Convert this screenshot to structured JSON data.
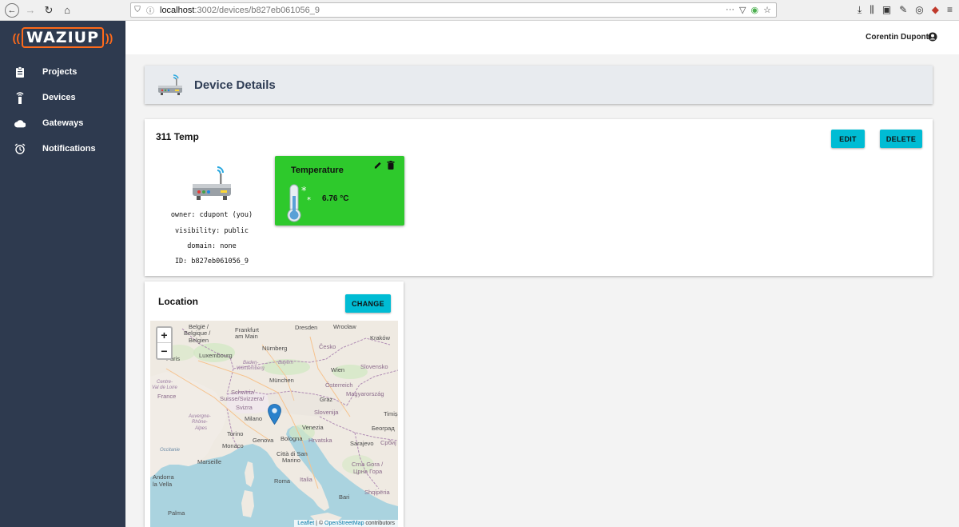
{
  "browser": {
    "url_host": "localhost",
    "url_path": ":3002/devices/b827eb061056_9",
    "url_more": "···"
  },
  "sidebar": {
    "logo_text": "WAZIUP",
    "items": [
      {
        "label": "Projects",
        "icon": "clipboard-icon"
      },
      {
        "label": "Devices",
        "icon": "antenna-icon"
      },
      {
        "label": "Gateways",
        "icon": "cloud-icon"
      },
      {
        "label": "Notifications",
        "icon": "alarm-icon"
      }
    ]
  },
  "appbar": {
    "user_name": "Corentin Dupont"
  },
  "header": {
    "title": "Device Details"
  },
  "device": {
    "name": "311 Temp",
    "edit_label": "EDIT",
    "delete_label": "DELETE",
    "owner": "owner: cdupont (you)",
    "visibility": "visibility: public",
    "domain": "domain: none",
    "id": "ID: b827eb061056_9"
  },
  "sensor": {
    "title": "Temperature",
    "value": "6.76 °C",
    "color": "#2ec92c"
  },
  "location": {
    "title": "Location",
    "change_label": "CHANGE",
    "zoom_in": "+",
    "zoom_out": "−",
    "attribution_leaflet": "Leaflet",
    "attribution_sep": " | © ",
    "attribution_osm": "OpenStreetMap",
    "attribution_rest": " contributors",
    "labels": {
      "belgie": "België /",
      "belgique": "Belgique /",
      "belgien": "Belgien",
      "frankfurt": "Frankfurt",
      "am_main": "am Main",
      "dresden": "Dresden",
      "wroclaw": "Wrocław",
      "krakow": "Kraków",
      "cesko": "Česko",
      "luxembourg": "Luxembourg",
      "nurnberg": "Nürnberg",
      "paris": "Paris",
      "baden": "Baden-",
      "wurttemberg": "Württemberg",
      "bayern": "Bayern",
      "wien": "Wien",
      "slovensko": "Slovensko",
      "munchen": "München",
      "osterreich": "Österreich",
      "centre": "Centre-",
      "val_de_loire": "Val de Loire",
      "france": "France",
      "schweiz": "Schweiz/",
      "suisse": "Suisse/Svizzera/",
      "svizra": "Svizra",
      "graz": "Graz",
      "magyarorszag": "Magyarország",
      "slovenija": "Slovenija",
      "timisoara": "Timiș",
      "auvergne": "Auvergne-",
      "rhone": "Rhône-",
      "alpes": "Alpes",
      "milano": "Milano",
      "venezia": "Venezia",
      "torino": "Torino",
      "hrvatska": "Hrvatska",
      "beograd": "Београд",
      "genova": "Genova",
      "bologna": "Bologna",
      "monaco": "Monaco",
      "sarajevo": "Sarajevo",
      "srbija": "Србиј",
      "occitanie": "Occitanie",
      "citta_di_san": "Città di San",
      "marino": "Marino",
      "marseille": "Marseille",
      "crna_gora": "Crna Gora /",
      "crna_gora_cyr": "Црна Гора",
      "andorra": "Andorra",
      "la_vella": "la Vella",
      "roma": "Roma",
      "italia": "Italia",
      "shqiperia": "Shqipëria",
      "bari": "Bari",
      "palma": "Palma"
    }
  }
}
